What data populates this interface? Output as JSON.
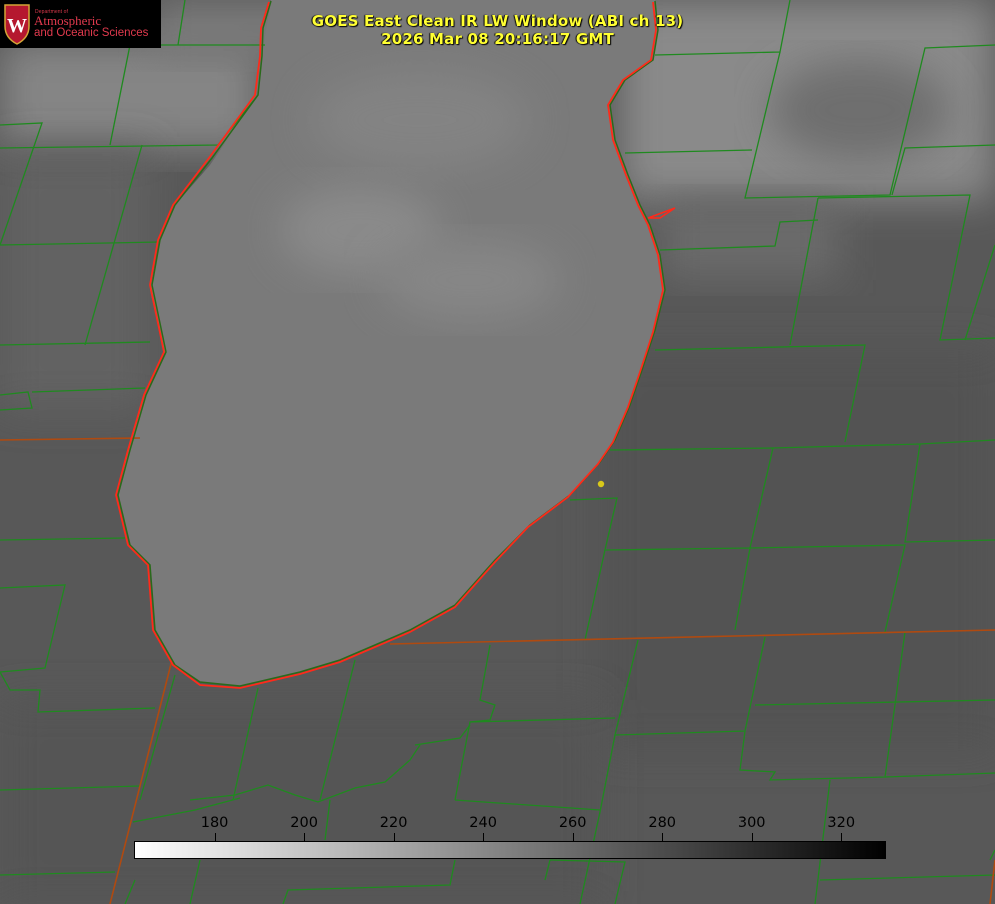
{
  "title": {
    "line1": "GOES East Clean IR LW Window (ABI ch 13)",
    "line2": "2026 Mar 08 20:16:17 GMT"
  },
  "logo": {
    "department": "Department of",
    "line1": "Atmospheric",
    "line2": "and Oceanic Sciences",
    "seal_letter": "W"
  },
  "colorbar": {
    "ticks": [
      "180",
      "200",
      "220",
      "240",
      "260",
      "280",
      "300",
      "320"
    ],
    "min_value": 162,
    "max_value": 330,
    "color_low": "#ffffff",
    "color_high": "#000000"
  },
  "colors": {
    "county_lines": "#1f8a1f",
    "coastline": "#ff2a1a",
    "state_lines": "#b04a10",
    "lake": "#7c7c7c",
    "land": "#575757",
    "marker": "#d8c81a",
    "title": "#ffff33"
  }
}
